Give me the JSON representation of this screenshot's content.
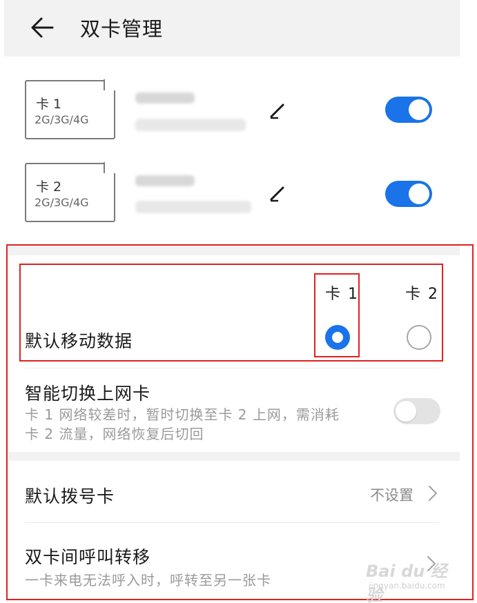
{
  "header": {
    "title": "双卡管理",
    "back_icon": "arrow-left-icon"
  },
  "sim_cards": [
    {
      "slot": "卡 1",
      "network": "2G/3G/4G",
      "enabled": true,
      "edit_icon": "pencil-icon"
    },
    {
      "slot": "卡 2",
      "network": "2G/3G/4G",
      "enabled": true,
      "edit_icon": "pencil-icon"
    }
  ],
  "default_data": {
    "label": "默认移动数据",
    "columns": [
      "卡 1",
      "卡 2"
    ],
    "selected": "卡 1"
  },
  "smart_switch": {
    "label": "智能切换上网卡",
    "description_line1": "卡 1 网络较差时，暂时切换至卡 2 上网，需消耗",
    "description_line2": "卡 2 流量，网络恢复后切回",
    "enabled": false
  },
  "default_dial": {
    "label": "默认拨号卡",
    "value": "不设置",
    "chevron_icon": "chevron-right-icon"
  },
  "call_forward": {
    "label": "双卡间呼叫转移",
    "description": "一卡来电无法呼入时，呼转至另一张卡",
    "chevron_icon": "chevron-right-icon"
  },
  "watermark": {
    "brand": "Bai du 经验",
    "url": "jingyan.baidu.com"
  },
  "colors": {
    "accent": "#1a73e8",
    "highlight_border": "#e02020",
    "section_bg": "#f2f2f2",
    "secondary_text": "#9a9a9a"
  }
}
